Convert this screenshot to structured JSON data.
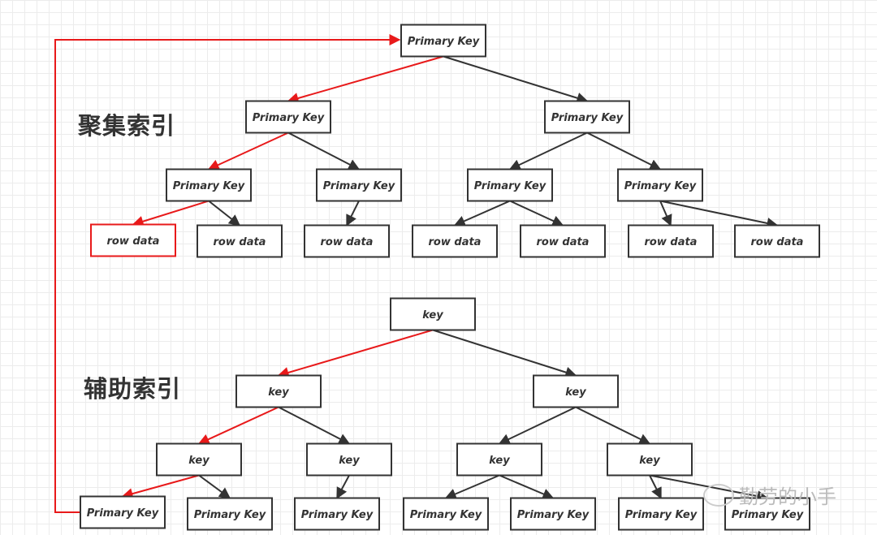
{
  "clustered_index": {
    "title": "聚集索引",
    "nodes": [
      "Primary Key",
      "Primary Key",
      "Primary Key",
      "Primary Key",
      "Primary Key",
      "Primary Key",
      "Primary Key"
    ],
    "leaves": [
      "row data",
      "row data",
      "row data",
      "row data",
      "row data",
      "row data",
      "row data"
    ]
  },
  "secondary_index": {
    "title": "辅助索引",
    "nodes": [
      "key",
      "key",
      "key",
      "key",
      "key",
      "key",
      "key"
    ],
    "leaves": [
      "Primary Key",
      "Primary Key",
      "Primary Key",
      "Primary Key",
      "Primary Key",
      "Primary Key",
      "Primary Key"
    ]
  },
  "watermark": "勤劳的小手",
  "colors": {
    "highlight": "#e8191a",
    "edge": "#333333",
    "box": "#333333"
  }
}
